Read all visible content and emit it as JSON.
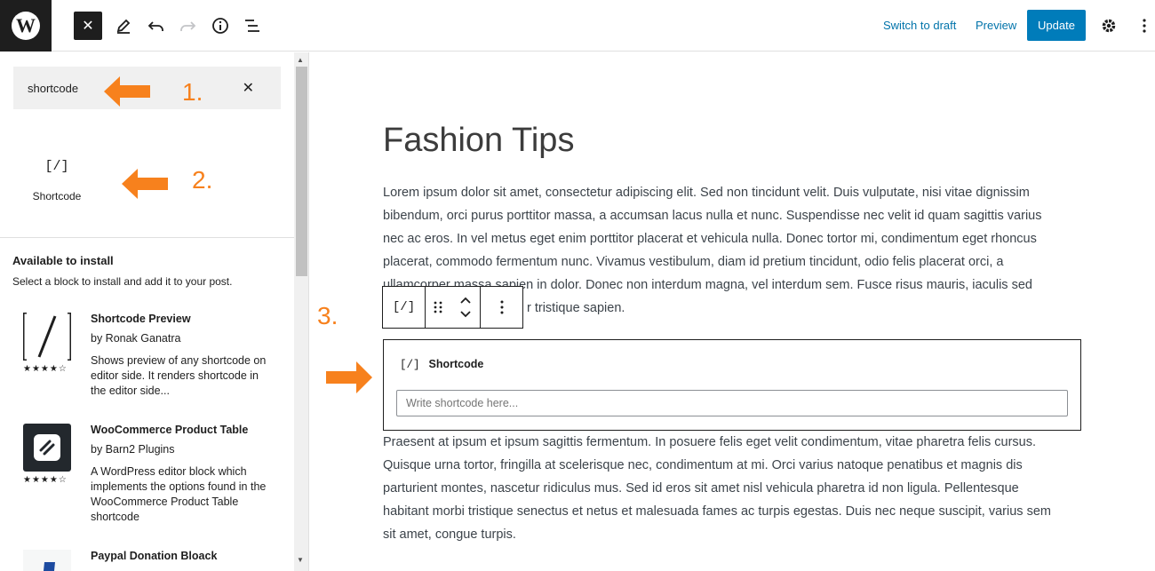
{
  "topbar": {
    "logo_letter": "W",
    "close_symbol": "✕",
    "switch_to_draft": "Switch to draft",
    "preview": "Preview",
    "update": "Update"
  },
  "sidebar": {
    "search_value": "shortcode",
    "clear_symbol": "✕",
    "block_result": {
      "icon": "[/]",
      "label": "Shortcode"
    },
    "available_title": "Available to install",
    "available_subtitle": "Select a block to install and add it to your post.",
    "plugins": [
      {
        "name": "Shortcode Preview",
        "by": "by Ronak Ganatra",
        "desc": "Shows preview of any shortcode on editor side. It renders shortcode in the editor side...",
        "stars": "★★★★☆"
      },
      {
        "name": "WooCommerce Product Table",
        "by": "by Barn2 Plugins",
        "desc": "A WordPress editor block which implements the options found in the WooCommerce Product Table shortcode",
        "stars": "★★★★☆"
      },
      {
        "name": "Paypal Donation Bloack",
        "by": "",
        "desc": "",
        "stars": ""
      }
    ]
  },
  "annotations": {
    "one": "1.",
    "two": "2.",
    "three": "3."
  },
  "editor": {
    "title": "Fashion Tips",
    "para1_lines": [
      "Lorem ipsum dolor sit amet, consectetur adipiscing elit. Sed non tincidunt velit. Duis vulputate, nisi vitae dignissim",
      "bibendum, orci purus porttitor massa, a accumsan lacus nulla et nunc. Suspendisse nec velit id quam sagittis varius",
      "nec ac eros. In vel metus eget enim porttitor placerat et vehicula nulla. Donec tortor mi, condimentum eget rhoncus",
      "placerat, commodo fermentum nunc. Vivamus vestibulum, diam id pretium tincidunt, odio felis placerat orci, a",
      "ullamcorper massa sapien in dolor. Donec non interdum magna, vel interdum sem. Fusce risus mauris, iaculis sed",
      "r tristique sapien."
    ],
    "shortcode_block": {
      "icon": "[/]",
      "label": "Shortcode",
      "placeholder": "Write shortcode here..."
    },
    "toolbar_icon": "[/]",
    "para2_lines": [
      "Praesent at ipsum et ipsum sagittis fermentum. In posuere felis eget velit condimentum, vitae pharetra felis cursus.",
      "Quisque urna tortor, fringilla at scelerisque nec, condimentum at mi. Orci varius natoque penatibus et magnis dis",
      "parturient montes, nascetur ridiculus mus. Sed id eros sit amet nisl vehicula pharetra id non ligula. Pellentesque",
      "habitant morbi tristique senectus et netus et malesuada fames ac turpis egestas. Duis nec neque suscipit, varius sem",
      "sit amet, congue turpis."
    ]
  },
  "colors": {
    "accent": "#007cba",
    "annotation": "#f7811d",
    "link": "#0073aa"
  },
  "icons": [
    "wordpress-logo-icon",
    "close-icon",
    "pencil-icon",
    "undo-icon",
    "redo-icon",
    "info-icon",
    "list-view-icon",
    "gear-icon",
    "more-vertical-icon",
    "drag-handle-icon",
    "move-up-down-icon"
  ]
}
